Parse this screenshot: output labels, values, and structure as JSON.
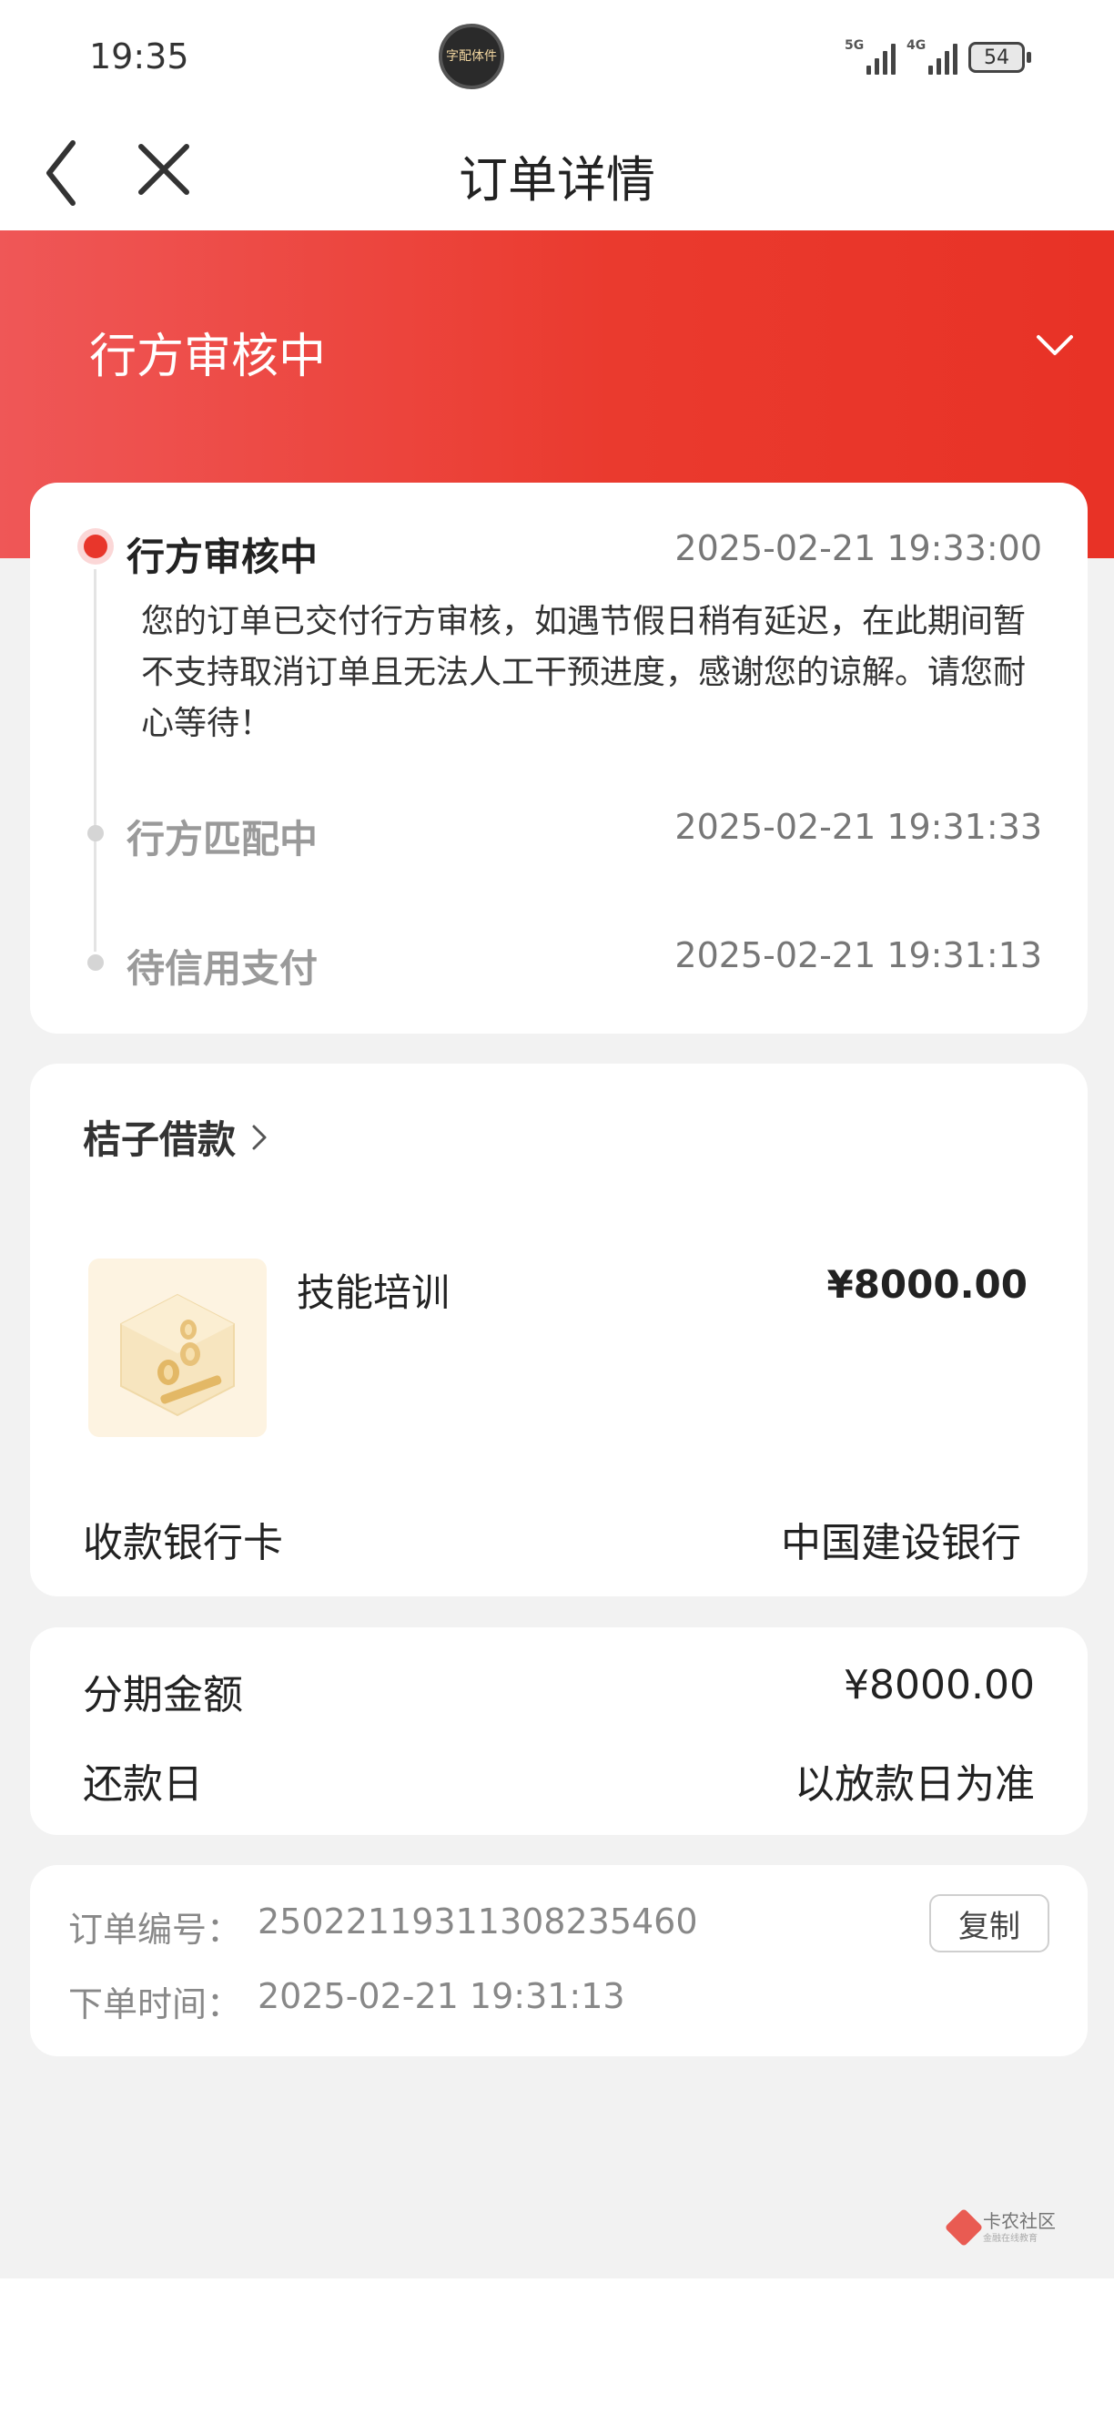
{
  "status_bar": {
    "time": "19:35",
    "app_icon_text": "字配体件",
    "network_1": "5G",
    "network_2": "4G",
    "battery": "54"
  },
  "nav": {
    "title": "订单详情",
    "back_icon": "chevron-left-icon",
    "close_icon": "close-icon"
  },
  "header": {
    "status_title": "行方审核中",
    "expand_icon": "chevron-down-icon",
    "gradient_start": "#ef5757",
    "gradient_end": "#e83226"
  },
  "timeline": [
    {
      "title": "行方审核中",
      "time": "2025-02-21 19:33:00",
      "active": true,
      "description": "您的订单已交付行方审核，如遇节假日稍有延迟，在此期间暂不支持取消订单且无法人工干预进度，感谢您的谅解。请您耐心等待！"
    },
    {
      "title": "行方匹配中",
      "time": "2025-02-21 19:31:33",
      "active": false
    },
    {
      "title": "待信用支付",
      "time": "2025-02-21 19:31:13",
      "active": false
    }
  ],
  "product_card": {
    "merchant": "桔子借款",
    "product_name": "技能培训",
    "price": "¥8000.00",
    "bank_label": "收款银行卡",
    "bank_value": "中国建设银行"
  },
  "amount_card": {
    "installment_label": "分期金额",
    "installment_value": "¥8000.00",
    "repay_label": "还款日",
    "repay_value": "以放款日为准"
  },
  "order_card": {
    "order_no_label": "订单编号：",
    "order_no_value": "250221193113082354​60",
    "order_time_label": "下单时间：",
    "order_time_value": "2025-02-21 19:31:13",
    "copy_label": "复制"
  },
  "watermark": {
    "name": "卡农社区",
    "sub": "金融在线教育"
  },
  "colors": {
    "accent_red": "#e8362b",
    "background": "#f2f2f2"
  }
}
